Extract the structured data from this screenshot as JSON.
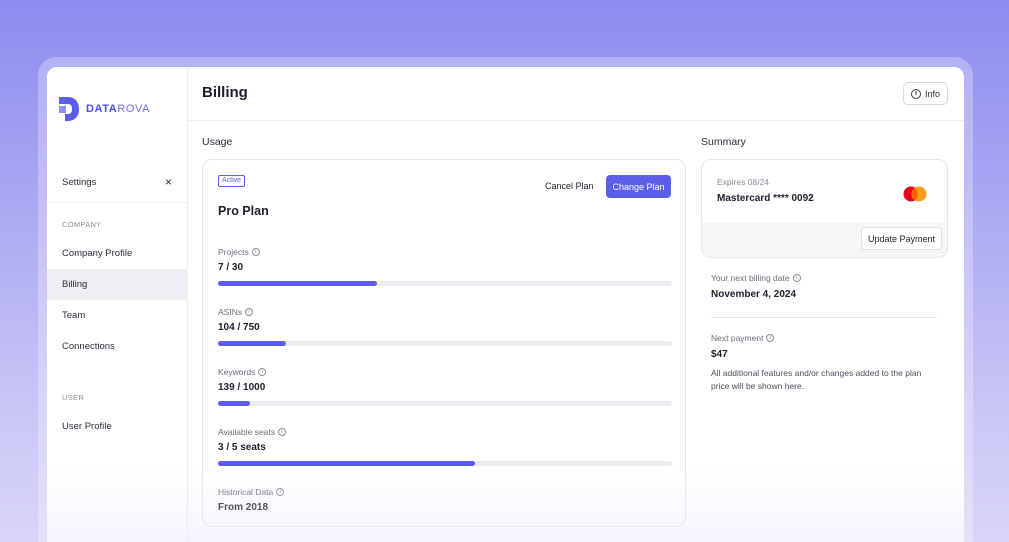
{
  "brand": {
    "logo_text_bold": "DATA",
    "logo_text_light": "ROVA",
    "accent": "#5b5ee8"
  },
  "sidebar": {
    "settings_label": "Settings",
    "close_icon": "×",
    "company_section": "COMPANY",
    "user_section": "USER",
    "items": [
      {
        "label": "Company Profile",
        "active": false
      },
      {
        "label": "Billing",
        "active": true
      },
      {
        "label": "Team",
        "active": false
      },
      {
        "label": "Connections",
        "active": false
      },
      {
        "label": "User Profile",
        "active": false
      }
    ]
  },
  "header": {
    "title": "Billing",
    "info_label": "Info",
    "info_icon": "i"
  },
  "usage": {
    "heading": "Usage",
    "badge": "Active",
    "plan_name": "Pro Plan",
    "cancel_label": "Cancel Plan",
    "change_label": "Change Plan",
    "metrics": [
      {
        "label": "Projects",
        "value": "7 / 30",
        "progress": 0.35
      },
      {
        "label": "ASINs",
        "value": "104 / 750",
        "progress": 0.15
      },
      {
        "label": "Keywords",
        "value": "139 / 1000",
        "progress": 0.07
      },
      {
        "label": "Available seats",
        "value": "3 / 5 seats",
        "progress": 0.565
      },
      {
        "label": "Historical Data",
        "value": "From 2018"
      }
    ]
  },
  "summary": {
    "heading": "Summary",
    "expires": "Expires 08/24",
    "card": "Mastercard **** 0092",
    "card_icon": "mastercard-icon",
    "update_label": "Update Payment",
    "next_billing_label": "Your next billing date",
    "next_billing_date": "November 4, 2024",
    "next_payment_label": "Next payment",
    "next_payment_amount": "$47",
    "next_payment_note": "All additional features and/or changes added to the plan price will be shown here."
  }
}
